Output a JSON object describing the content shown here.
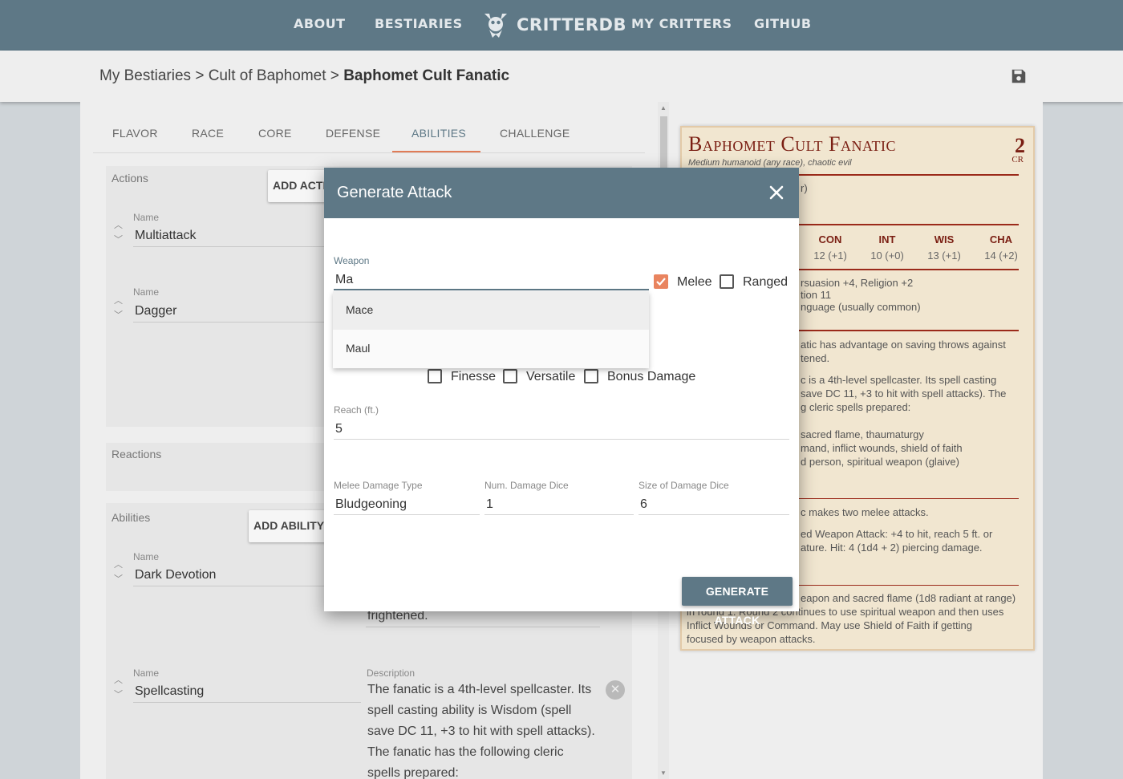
{
  "nav": {
    "about": "ABOUT",
    "bestiaries": "BESTIARIES",
    "logo": "CRITTERDB",
    "my_critters": "MY CRITTERS",
    "github": "GITHUB"
  },
  "breadcrumb": {
    "root": "My Bestiaries",
    "sep1": ">",
    "bestiary": "Cult of Baphomet",
    "sep2": ">",
    "current": "Baphomet Cult Fanatic"
  },
  "tabs": [
    "FLAVOR",
    "RACE",
    "CORE",
    "DEFENSE",
    "ABILITIES",
    "CHALLENGE"
  ],
  "active_tab": "ABILITIES",
  "actions": {
    "title": "Actions",
    "add_label": "ADD ACTION",
    "items": [
      {
        "name_label": "Name",
        "name": "Multiattack"
      },
      {
        "name_label": "Name",
        "name": "Dagger"
      }
    ]
  },
  "reactions": {
    "title": "Reactions"
  },
  "abilities": {
    "title": "Abilities",
    "add_label": "ADD ABILITY",
    "items": [
      {
        "name_label": "Name",
        "name": "Dark Devotion",
        "desc_tail": "frightened."
      },
      {
        "name_label": "Name",
        "name": "Spellcasting",
        "desc_label": "Description",
        "desc_lines": [
          "The fanatic is a 4th-level spellcaster. Its",
          "spell casting ability is Wisdom (spell",
          "save DC 11, +3 to hit with spell attacks).",
          "The fanatic has the following cleric",
          "spells prepared:"
        ]
      }
    ]
  },
  "statblock": {
    "name": "Baphomet Cult Fanatic",
    "subtitle": "Medium humanoid (any race), chaotic evil",
    "cr": "2",
    "cr_label": "CR",
    "armor_fragment": "r)",
    "stats": [
      {
        "k": "CON",
        "v": "12 (+1)"
      },
      {
        "k": "INT",
        "v": "10 (+0)"
      },
      {
        "k": "WIS",
        "v": "13 (+1)"
      },
      {
        "k": "CHA",
        "v": "14 (+2)"
      }
    ],
    "props_lines": [
      "rsuasion +4, Religion +2",
      "tion 11",
      "nguage (usually common)"
    ],
    "trait_lines": [
      "atic has advantage on saving throws against",
      "tened."
    ],
    "spell_lines": [
      "c is a 4th-level spellcaster. Its spell casting",
      "save DC 11, +3 to hit with spell attacks). The",
      "g cleric spells prepared:"
    ],
    "spell_list_lines": [
      "sacred flame, thaumaturgy",
      "mand, inflict wounds, shield of faith",
      "d person, spiritual weapon (glaive)"
    ],
    "action_lines": [
      "c makes two melee attacks."
    ],
    "dagger_lines": [
      "ed Weapon Attack: +4 to hit, reach 5 ft. or",
      "ature. Hit: 4 (1d4 + 2) piercing damage."
    ],
    "tactics_lines": [
      "eapon and sacred flame (1d8 radiant at range)",
      "in round 1. Round 2 continues to use spiritual weapon and then uses",
      "Inflict Wounds or Command. May use Shield of Faith if getting",
      "focused by weapon attacks."
    ]
  },
  "modal": {
    "title": "Generate Attack",
    "weapon_label": "Weapon",
    "weapon_value": "Ma",
    "melee_label": "Melee",
    "melee_checked": true,
    "ranged_label": "Ranged",
    "ranged_checked": false,
    "suggestions": [
      "Mace",
      "Maul"
    ],
    "finesse_label": "Finesse",
    "versatile_label": "Versatile",
    "bonus_damage_label": "Bonus Damage",
    "reach_label": "Reach (ft.)",
    "reach_value": "5",
    "damage_type_label": "Melee Damage Type",
    "damage_type_value": "Bludgeoning",
    "num_dice_label": "Num. Damage Dice",
    "num_dice_value": "1",
    "dice_size_label": "Size of Damage Dice",
    "dice_size_value": "6",
    "generate_label": "GENERATE ATTACK"
  },
  "colors": {
    "primary": "#5e7886",
    "accent": "#e07c57",
    "statblock_bg": "#f1e6d0",
    "statblock_heading": "#7a1e12"
  }
}
